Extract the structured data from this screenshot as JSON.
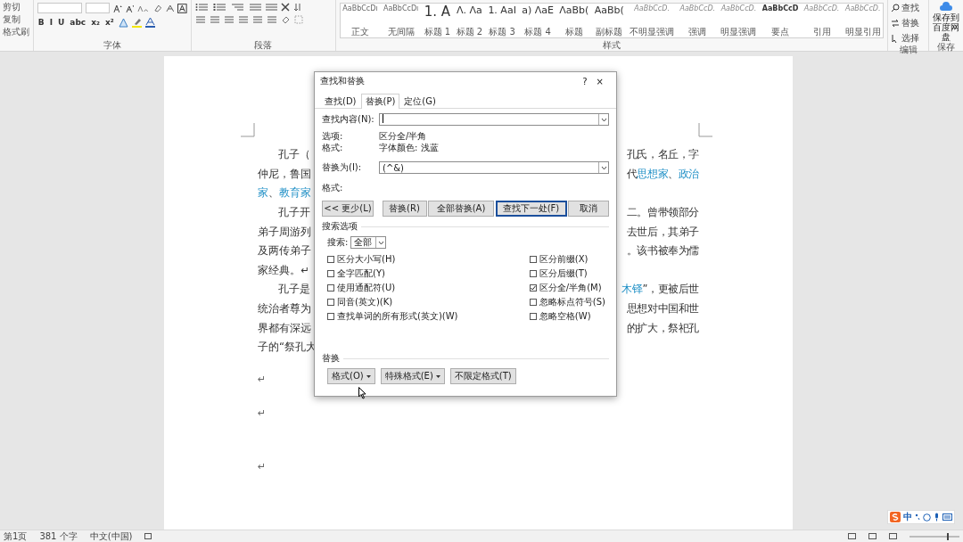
{
  "ribbon": {
    "clipboard": [
      "剪切",
      "复制",
      "格式刷"
    ],
    "font": {
      "label": "字体",
      "format_buttons": [
        "B",
        "I",
        "U",
        "abc",
        "x₂",
        "x²"
      ]
    },
    "paragraph": {
      "label": "段落"
    },
    "styles": {
      "label": "样式",
      "items": [
        {
          "preview": "AaBbCcDı",
          "name": "正文",
          "kind": "small"
        },
        {
          "preview": "AaBbCcDı",
          "name": "无间隔",
          "kind": "small"
        },
        {
          "preview": "1. A",
          "name": "标题 1",
          "kind": "large"
        },
        {
          "preview": "Λ. Λa",
          "name": "标题 2",
          "kind": "medium"
        },
        {
          "preview": "1. AaI",
          "name": "标题 3",
          "kind": "medium"
        },
        {
          "preview": "a) ΛaE",
          "name": "标题 4",
          "kind": "medium"
        },
        {
          "preview": "ΛaBb(",
          "name": "标题",
          "kind": "medium"
        },
        {
          "preview": "AaBb(",
          "name": "副标题",
          "kind": "medium"
        },
        {
          "preview": "AaBbCcD.",
          "name": "不明显强调",
          "kind": "italic"
        },
        {
          "preview": "AaBbCcD.",
          "name": "强调",
          "kind": "italic"
        },
        {
          "preview": "AaBbCcD.",
          "name": "明显强调",
          "kind": "italic"
        },
        {
          "preview": "AaBbCcD",
          "name": "要点",
          "kind": "bold"
        },
        {
          "preview": "AaBbCcD.",
          "name": "引用",
          "kind": "italic"
        },
        {
          "preview": "AaBbCcD.",
          "name": "明显引用",
          "kind": "italic"
        }
      ]
    },
    "editing": {
      "label": "编辑",
      "items": [
        "查找",
        "替换",
        "选择"
      ]
    },
    "save": {
      "label": "保存",
      "button": "保存到百度网盘"
    }
  },
  "document": {
    "lines": [
      {
        "indent": true,
        "left": [
          {
            "text": "孔子（",
            "highlighted": false
          }
        ],
        "right": [
          {
            "text": "孔氏，名丘，字",
            "highlighted": false
          }
        ]
      },
      {
        "indent": false,
        "left": [
          {
            "text": "仲尼，鲁国",
            "highlighted": false
          }
        ],
        "right": [
          {
            "text": "代",
            "highlighted": false
          },
          {
            "text": "思想家",
            "highlighted": true
          },
          {
            "text": "、",
            "highlighted": false
          },
          {
            "text": "政治",
            "highlighted": true
          }
        ]
      },
      {
        "indent": false,
        "left": [
          {
            "text": "家",
            "highlighted": true
          },
          {
            "text": "、",
            "highlighted": false
          },
          {
            "text": "教育家",
            "highlighted": true
          }
        ]
      },
      {
        "indent": true,
        "left": [
          {
            "text": "孔子开",
            "highlighted": false
          }
        ],
        "right": [
          {
            "text": "二。曾带领部分",
            "highlighted": false
          }
        ]
      },
      {
        "indent": false,
        "left": [
          {
            "text": "弟子周游列",
            "highlighted": false
          }
        ],
        "right": [
          {
            "text": "去世后，其弟子",
            "highlighted": false
          }
        ]
      },
      {
        "indent": false,
        "left": [
          {
            "text": "及两传弟子",
            "highlighted": false
          }
        ],
        "right": [
          {
            "text": "。该书被奉为儒",
            "highlighted": false
          }
        ]
      },
      {
        "indent": false,
        "left": [
          {
            "text": "家经典。↵",
            "highlighted": false
          }
        ]
      },
      {
        "indent": true,
        "left": [
          {
            "text": "孔子是",
            "highlighted": false
          }
        ],
        "right": [
          {
            "text": "木铎",
            "highlighted": true
          },
          {
            "text": "”，更被后世",
            "highlighted": false
          }
        ]
      },
      {
        "indent": false,
        "left": [
          {
            "text": "统治者尊为",
            "highlighted": false
          }
        ],
        "right": [
          {
            "text": "思想对中国和世",
            "highlighted": false
          }
        ]
      },
      {
        "indent": false,
        "left": [
          {
            "text": "界都有深远",
            "highlighted": false
          }
        ],
        "right": [
          {
            "text": "的扩大，祭祀孔",
            "highlighted": false
          }
        ]
      },
      {
        "indent": false,
        "left": [
          {
            "text": "子的“祭孔大",
            "highlighted": false
          }
        ]
      }
    ],
    "paragraph_marks": [
      "↵",
      "↵",
      "↵"
    ]
  },
  "dialog": {
    "title": "查找和替换",
    "help": "?",
    "close": "×",
    "tabs": [
      {
        "label": "查找(D)",
        "selected": false
      },
      {
        "label": "替换(P)",
        "selected": true
      },
      {
        "label": "定位(G)",
        "selected": false
      }
    ],
    "find_label": "查找内容(N):",
    "options_label": "选项:",
    "options_value": "区分全/半角",
    "format_label": "格式:",
    "format_value": "字体颜色: 浅蓝",
    "replace_label": "替换为(I):",
    "replace_value": "(^&)",
    "replace_format_label": "格式:",
    "buttons": [
      "<< 更少(L)",
      "替换(R)",
      "全部替换(A)",
      "查找下一处(F)",
      "取消"
    ],
    "search_options_label": "搜索选项",
    "search_label": "搜索:",
    "search_value": "全部",
    "left_options": [
      {
        "label": "区分大小写(H)",
        "checked": false
      },
      {
        "label": "全字匹配(Y)",
        "checked": false
      },
      {
        "label": "使用通配符(U)",
        "checked": false
      },
      {
        "label": "同音(英文)(K)",
        "checked": false
      },
      {
        "label": "查找单词的所有形式(英文)(W)",
        "checked": false
      }
    ],
    "right_options": [
      {
        "label": "区分前缀(X)",
        "checked": false
      },
      {
        "label": "区分后缀(T)",
        "checked": false
      },
      {
        "label": "区分全/半角(M)",
        "checked": true
      },
      {
        "label": "忽略标点符号(S)",
        "checked": false
      },
      {
        "label": "忽略空格(W)",
        "checked": false
      }
    ],
    "replace_section_label": "替换",
    "format_buttons": [
      {
        "label": "格式(O)",
        "dropdown": true
      },
      {
        "label": "特殊格式(E)",
        "dropdown": true
      },
      {
        "label": "不限定格式(T)",
        "dropdown": false
      }
    ]
  },
  "ime": {
    "mode": "中"
  },
  "status_bar": {
    "page": "第1页",
    "words": "381 个字",
    "language": "中文(中国)"
  }
}
